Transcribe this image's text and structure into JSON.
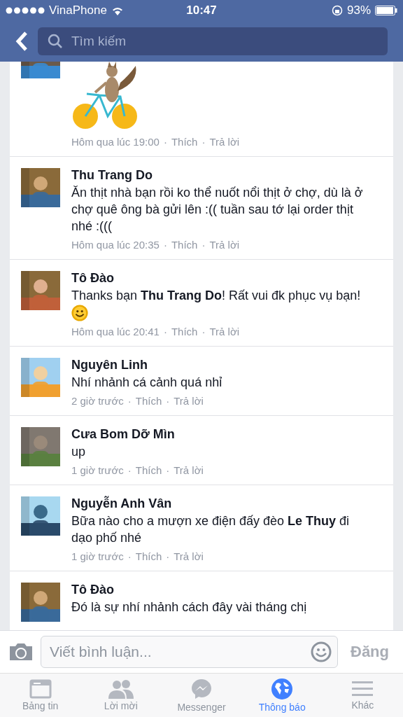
{
  "status_bar": {
    "carrier": "VinaPhone",
    "time": "10:47",
    "battery": "93%"
  },
  "search": {
    "placeholder": "Tìm kiếm"
  },
  "comments": [
    {
      "kind": "sticker",
      "meta": "Hôm qua lúc 19:00",
      "sep": "·",
      "like": "Thích",
      "reply": "Trả lời"
    },
    {
      "kind": "text",
      "name": "Thu Trang Do",
      "text": "Ăn thịt nhà bạn rồi ko thể nuốt nổi thịt ở chợ, dù là ở chợ quê ông bà gửi lên :(( tuần sau tớ lại order thịt nhé :(((",
      "emoji": false,
      "meta": "Hôm qua lúc 20:35",
      "sep": "·",
      "like": "Thích",
      "reply": "Trả lời"
    },
    {
      "kind": "text",
      "name": "Tô Đào",
      "text": "Thanks bạn **Thu Trang Do**! Rất vui đk phục vụ bạn!",
      "emoji": true,
      "meta": "Hôm qua lúc 20:41",
      "sep": "·",
      "like": "Thích",
      "reply": "Trả lời"
    },
    {
      "kind": "text",
      "name": "Nguyên Linh",
      "text": "Nhí nhảnh cá cảnh quá nhỉ",
      "emoji": false,
      "meta": "2 giờ trước",
      "sep": "·",
      "like": "Thích",
      "reply": "Trả lời"
    },
    {
      "kind": "text",
      "name": "Cưa Bom Dỡ Mìn",
      "text": "up",
      "emoji": false,
      "meta": "1 giờ trước",
      "sep": "·",
      "like": "Thích",
      "reply": "Trả lời"
    },
    {
      "kind": "text",
      "name": "Nguyễn Anh Vân",
      "text": "Bữa nào cho a mượn xe điện đấy đèo **Le Thuy** đi dạo phố nhé",
      "emoji": false,
      "meta": "1 giờ trước",
      "sep": "·",
      "like": "Thích",
      "reply": "Trả lời"
    },
    {
      "kind": "text",
      "name": "Tô Đào",
      "text": "Đó là sự nhí nhảnh cách đây vài tháng chị",
      "emoji": false
    }
  ],
  "composer": {
    "placeholder": "Viết bình luận...",
    "post": "Đăng"
  },
  "tabs": [
    {
      "label": "Bảng tin",
      "selected": false
    },
    {
      "label": "Lời mời",
      "selected": false
    },
    {
      "label": "Messenger",
      "selected": false
    },
    {
      "label": "Thông báo",
      "selected": true
    },
    {
      "label": "Khác",
      "selected": false
    }
  ]
}
